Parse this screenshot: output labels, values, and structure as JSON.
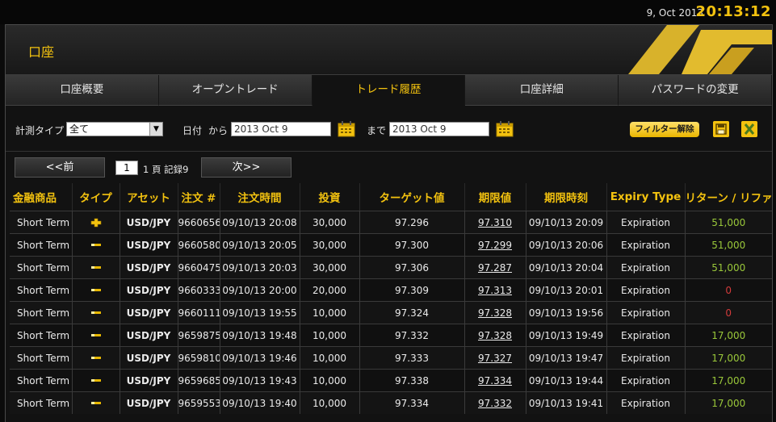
{
  "header": {
    "date": "9, Oct 2013",
    "clock": "20:13:12"
  },
  "panel": {
    "title": "口座"
  },
  "tabs": [
    {
      "label": "口座概要",
      "active": false
    },
    {
      "label": "オープントレード",
      "active": false
    },
    {
      "label": "トレード履歴",
      "active": true
    },
    {
      "label": "口座詳細",
      "active": false
    },
    {
      "label": "パスワードの変更",
      "active": false
    }
  ],
  "filter": {
    "type_label": "計測タイプ",
    "type_value": "全て",
    "date_label": "日付",
    "from_label": "から",
    "from_value": "2013 Oct 9",
    "to_label": "まで",
    "to_value": "2013 Oct 9",
    "filter_reset_label": "フィルター解除"
  },
  "pager": {
    "prev_label": "<<前",
    "page_value": "1",
    "info": "1 頁 記録9",
    "next_label": "次>>"
  },
  "table": {
    "columns": [
      "金融商品",
      "タイプ",
      "アセット",
      "注文 #",
      "注文時間",
      "投資",
      "ターゲット値",
      "期限値",
      "期限時刻",
      "Expiry Type",
      "リターン / リファンド"
    ],
    "rows": [
      {
        "product": "Short Term",
        "type": "up",
        "asset": "USD/JPY",
        "order": "9660656",
        "time": "09/10/13 20:08",
        "invest": "30,000",
        "target": "97.296",
        "expiry_value": "97.310",
        "expiry_time": "09/10/13 20:09",
        "expiry_type": "Expiration",
        "return": "51,000",
        "return_color": "green"
      },
      {
        "product": "Short Term",
        "type": "down",
        "asset": "USD/JPY",
        "order": "9660580",
        "time": "09/10/13 20:05",
        "invest": "30,000",
        "target": "97.300",
        "expiry_value": "97.299",
        "expiry_time": "09/10/13 20:06",
        "expiry_type": "Expiration",
        "return": "51,000",
        "return_color": "green"
      },
      {
        "product": "Short Term",
        "type": "down",
        "asset": "USD/JPY",
        "order": "9660475",
        "time": "09/10/13 20:03",
        "invest": "30,000",
        "target": "97.306",
        "expiry_value": "97.287",
        "expiry_time": "09/10/13 20:04",
        "expiry_type": "Expiration",
        "return": "51,000",
        "return_color": "green"
      },
      {
        "product": "Short Term",
        "type": "down",
        "asset": "USD/JPY",
        "order": "9660333",
        "time": "09/10/13 20:00",
        "invest": "20,000",
        "target": "97.309",
        "expiry_value": "97.313",
        "expiry_time": "09/10/13 20:01",
        "expiry_type": "Expiration",
        "return": "0",
        "return_color": "red"
      },
      {
        "product": "Short Term",
        "type": "down",
        "asset": "USD/JPY",
        "order": "9660111",
        "time": "09/10/13 19:55",
        "invest": "10,000",
        "target": "97.324",
        "expiry_value": "97.328",
        "expiry_time": "09/10/13 19:56",
        "expiry_type": "Expiration",
        "return": "0",
        "return_color": "red"
      },
      {
        "product": "Short Term",
        "type": "down",
        "asset": "USD/JPY",
        "order": "9659875",
        "time": "09/10/13 19:48",
        "invest": "10,000",
        "target": "97.332",
        "expiry_value": "97.328",
        "expiry_time": "09/10/13 19:49",
        "expiry_type": "Expiration",
        "return": "17,000",
        "return_color": "green"
      },
      {
        "product": "Short Term",
        "type": "down",
        "asset": "USD/JPY",
        "order": "9659810",
        "time": "09/10/13 19:46",
        "invest": "10,000",
        "target": "97.333",
        "expiry_value": "97.327",
        "expiry_time": "09/10/13 19:47",
        "expiry_type": "Expiration",
        "return": "17,000",
        "return_color": "green"
      },
      {
        "product": "Short Term",
        "type": "down",
        "asset": "USD/JPY",
        "order": "9659685",
        "time": "09/10/13 19:43",
        "invest": "10,000",
        "target": "97.338",
        "expiry_value": "97.334",
        "expiry_time": "09/10/13 19:44",
        "expiry_type": "Expiration",
        "return": "17,000",
        "return_color": "green"
      },
      {
        "product": "Short Term",
        "type": "down",
        "asset": "USD/JPY",
        "order": "9659553",
        "time": "09/10/13 19:40",
        "invest": "10,000",
        "target": "97.334",
        "expiry_value": "97.332",
        "expiry_time": "09/10/13 19:41",
        "expiry_type": "Expiration",
        "return": "17,000",
        "return_color": "green"
      }
    ]
  },
  "colors": {
    "accent": "#f3c20f",
    "gain": "#9ac83a",
    "loss": "#d23b3b"
  }
}
